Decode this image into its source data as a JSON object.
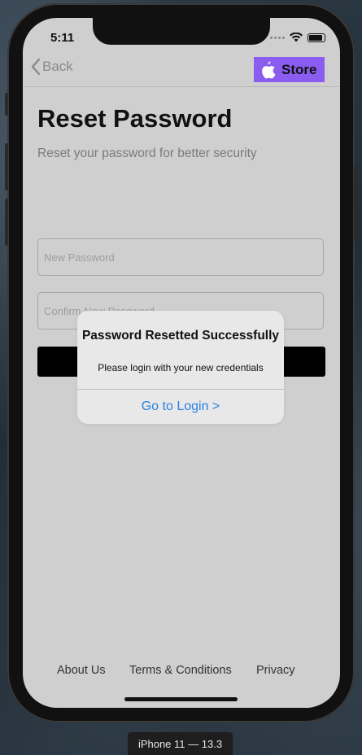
{
  "status_bar": {
    "time": "5:11",
    "icons": [
      "signal-dots-icon",
      "wifi-icon",
      "battery-icon"
    ]
  },
  "navbar": {
    "back_label": "Back",
    "store_label": "Store",
    "store_icon": "apple-logo-icon",
    "store_bg_color": "#8a5cf0"
  },
  "page": {
    "title": "Reset Password",
    "subtitle": "Reset your password for better security"
  },
  "form": {
    "new_password_placeholder": "New Password",
    "new_password_value": "",
    "confirm_password_placeholder": "Confirm New Password",
    "confirm_password_value": "",
    "submit_label": ""
  },
  "alert": {
    "title": "Password Resetted Successfully",
    "message": "Please login with your new credentials",
    "action_label": "Go to Login >",
    "action_color": "#2a82e4"
  },
  "footer": {
    "links": [
      "About Us",
      "Terms & Conditions",
      "Privacy"
    ]
  },
  "device": {
    "label": "iPhone 11 — 13.3"
  }
}
